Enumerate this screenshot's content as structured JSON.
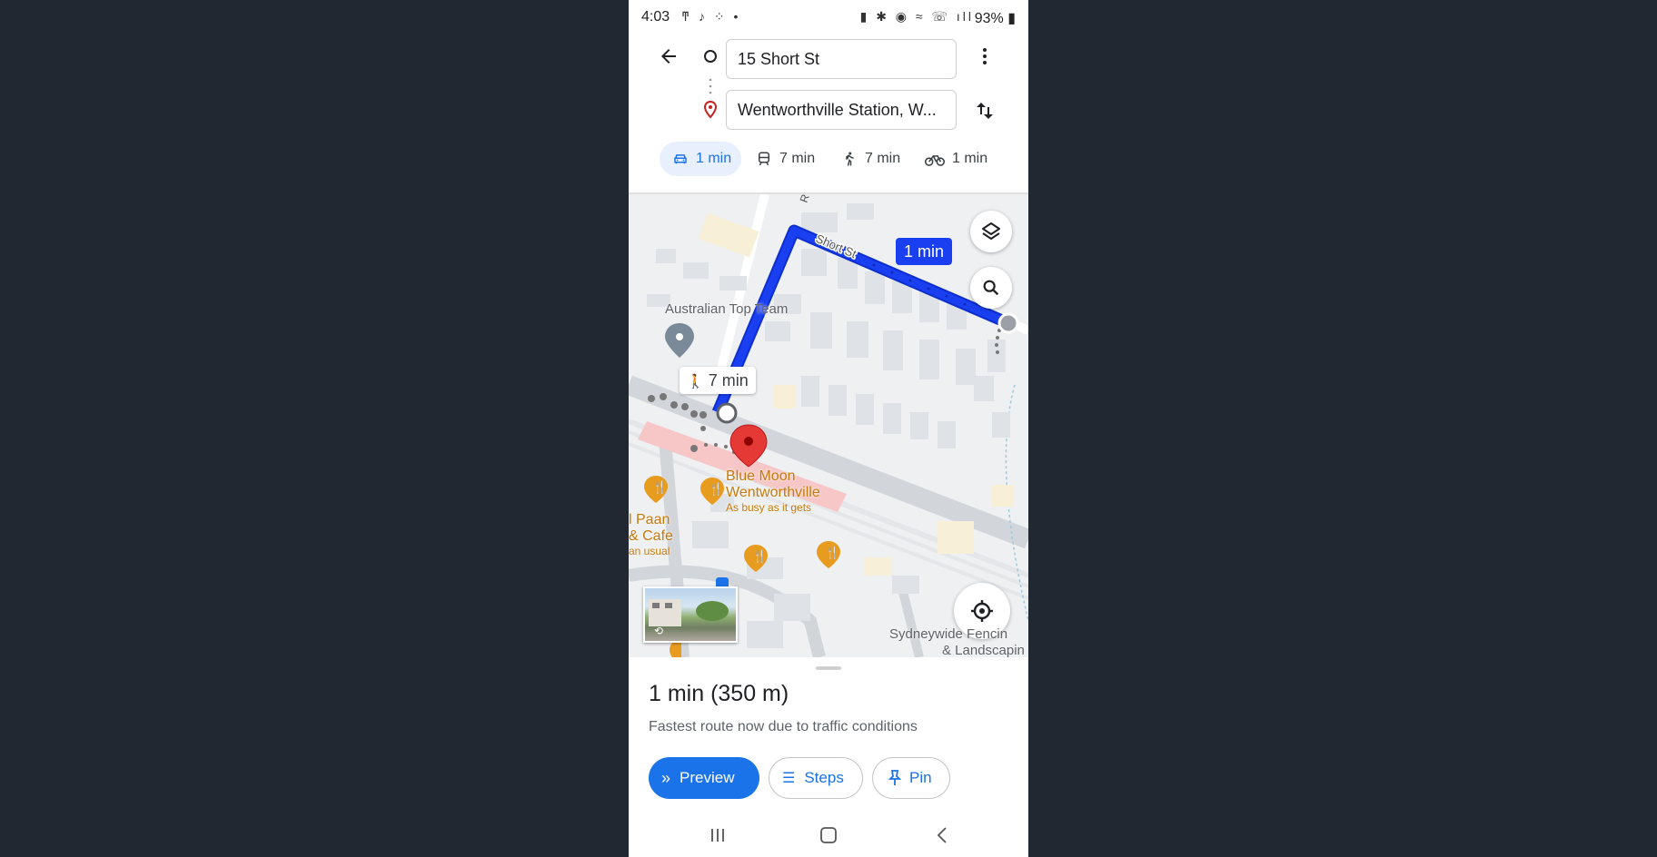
{
  "status_bar": {
    "time": "4:03",
    "left_icons": "ͳ ♪ ⁘ •",
    "right_icons": "▮ ✱ ◉ ≈ ☏ ıll",
    "battery": "93%"
  },
  "directions": {
    "origin": "15 Short St",
    "destination": "Wentworthville Station, W..."
  },
  "modes": [
    {
      "name": "driving",
      "label": "1 min",
      "icon": "car-icon",
      "active": true
    },
    {
      "name": "transit",
      "label": "7 min",
      "icon": "train-icon",
      "active": false
    },
    {
      "name": "walking",
      "label": "7 min",
      "icon": "walk-icon",
      "active": false
    },
    {
      "name": "cycling",
      "label": "1 min",
      "icon": "bike-icon",
      "active": false
    }
  ],
  "map": {
    "route_time_badge": "1 min",
    "walk_time_badge": "7 min",
    "street_labels": [
      "Short St",
      "R"
    ],
    "places": {
      "gym": "Australian Top Team",
      "restaurant_name_1": "Blue Moon",
      "restaurant_name_2": "Wentworthville",
      "restaurant_status": "As busy as it gets",
      "cafe_1": "l Paan",
      "cafe_2": "& Cafe",
      "cafe_3": "an usual",
      "business_1": "Sydneywide Fencin",
      "business_2": "& Landscapin"
    },
    "route_color": "#1a3ff0",
    "pin_color": "#e53935"
  },
  "summary": {
    "title": "1 min (350 m)",
    "subtitle": "Fastest route now due to traffic conditions",
    "buttons": {
      "preview": "Preview",
      "steps": "Steps",
      "pin": "Pin"
    }
  },
  "colors": {
    "accent": "#1a73e8",
    "background": "#212832"
  }
}
